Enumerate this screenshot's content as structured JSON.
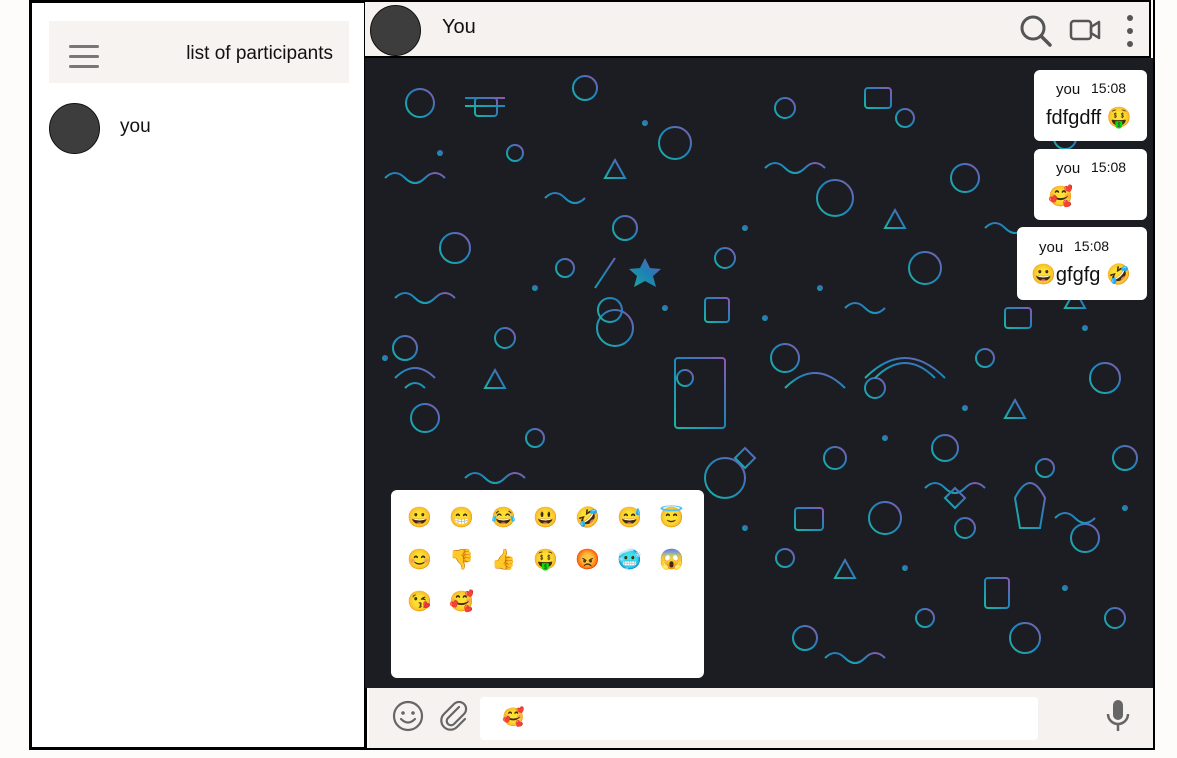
{
  "sidebar": {
    "title": "list of participants",
    "participants": [
      {
        "name": "you"
      }
    ]
  },
  "chat": {
    "title": "You",
    "messages": [
      {
        "author": "you",
        "time": "15:08",
        "text": "fdfgdff 🤑"
      },
      {
        "author": "you",
        "time": "15:08",
        "text": "🥰"
      },
      {
        "author": "you",
        "time": "15:08",
        "text": "😀gfgfg 🤣"
      }
    ]
  },
  "emoji_picker": {
    "emojis": [
      "😀",
      "😁",
      "😂",
      "😃",
      "🤣",
      "😅",
      "😇",
      "😊",
      "👎",
      "👍",
      "🤑",
      "😡",
      "🥶",
      "😱",
      "😘",
      "🥰"
    ]
  },
  "composer": {
    "value": "🥰"
  },
  "icons": {
    "search": "search-icon",
    "video": "video-camera-icon",
    "more": "more-vertical-icon",
    "emoji": "smiley-icon",
    "attach": "paperclip-icon",
    "mic": "microphone-icon",
    "menu": "hamburger-menu-icon"
  },
  "colors": {
    "wallpaper": "#1c1d22",
    "header_bg": "#f6f2f0",
    "avatar": "#3e3d3e",
    "doodle_teal": "#1fb5c9",
    "doodle_purple": "#8a5fb8"
  }
}
